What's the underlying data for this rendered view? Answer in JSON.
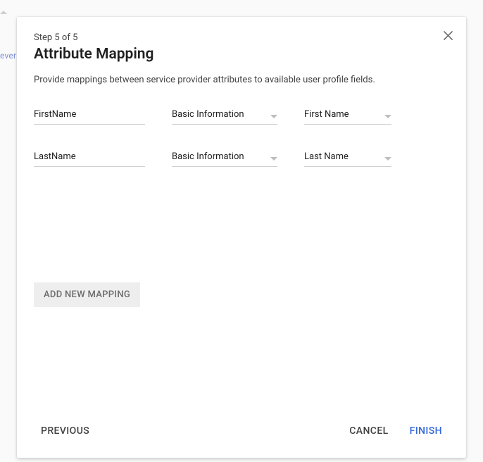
{
  "background": {
    "fragment_text": "ever"
  },
  "dialog": {
    "step_label": "Step 5 of 5",
    "title": "Attribute Mapping",
    "description": "Provide mappings between service provider attributes to available user profile fields.",
    "mappings": [
      {
        "attribute": "FirstName",
        "category": "Basic Information",
        "profile_field": "First Name"
      },
      {
        "attribute": "LastName",
        "category": "Basic Information",
        "profile_field": "Last Name"
      }
    ],
    "add_mapping_label": "ADD NEW MAPPING",
    "footer": {
      "previous": "PREVIOUS",
      "cancel": "CANCEL",
      "finish": "FINISH"
    },
    "icons": {
      "close": "close-icon",
      "dropdown": "chevron-down-icon"
    }
  }
}
